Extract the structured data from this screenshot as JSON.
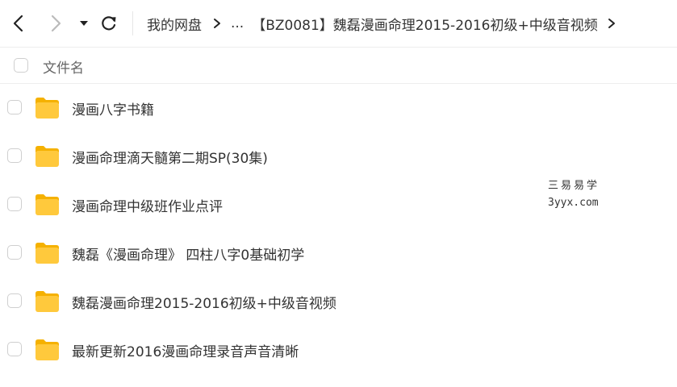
{
  "breadcrumb": {
    "root": "我的网盘",
    "ellipsis": "...",
    "current": "【BZ0081】魏磊漫画命理2015-2016初级+中级音视频"
  },
  "list_header": {
    "name_column": "文件名"
  },
  "files": [
    {
      "name": "漫画八字书籍",
      "type": "folder"
    },
    {
      "name": "漫画命理滴天髓第二期SP(30集)",
      "type": "folder"
    },
    {
      "name": "漫画命理中级班作业点评",
      "type": "folder"
    },
    {
      "name": "魏磊《漫画命理》 四柱八字0基础初学",
      "type": "folder"
    },
    {
      "name": "魏磊漫画命理2015-2016初级+中级音视频",
      "type": "folder"
    },
    {
      "name": "最新更新2016漫画命理录音声音清晰",
      "type": "folder"
    }
  ],
  "watermark": {
    "line1": "三易易学",
    "line2": "3yyx.com"
  },
  "colors": {
    "folder": "#FFC93C",
    "folder_tab": "#F5B100",
    "border": "#eeeeee"
  }
}
